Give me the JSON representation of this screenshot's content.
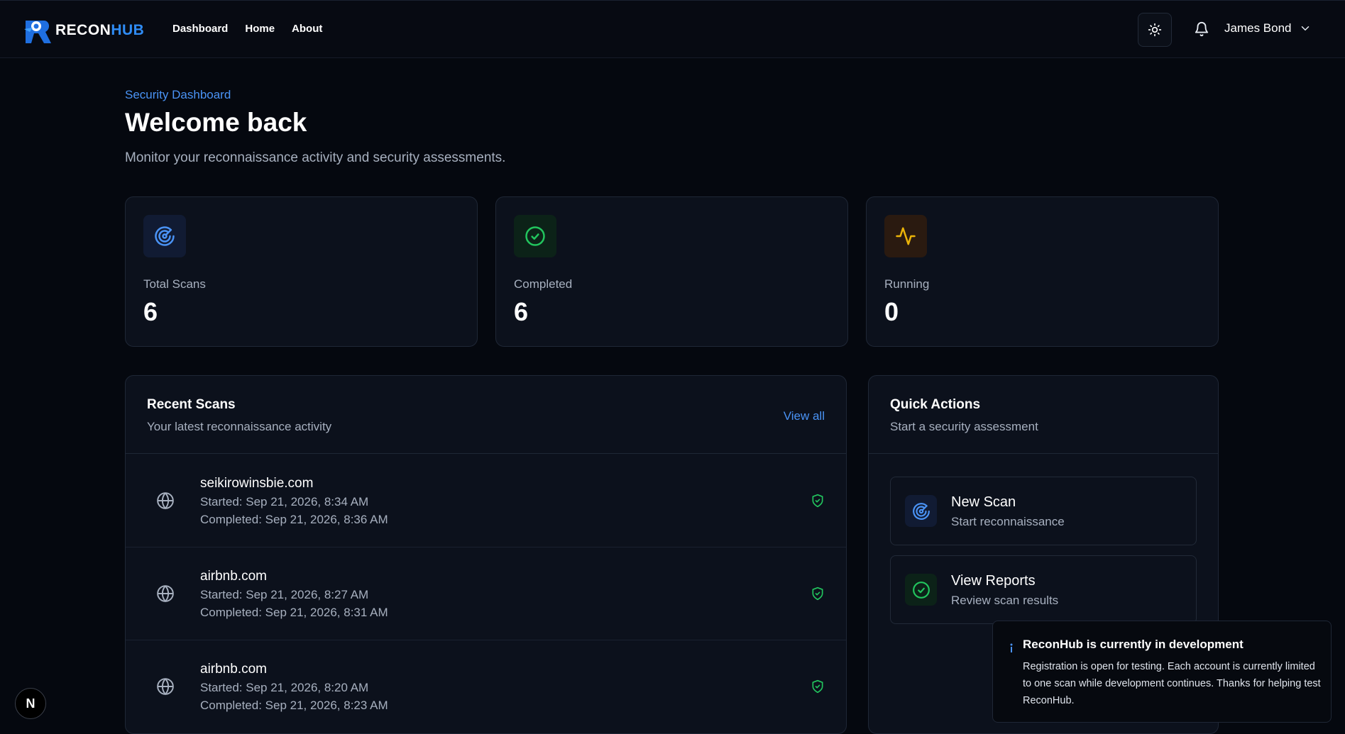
{
  "brand": {
    "name_part1": "RECON",
    "name_part2": "HUB",
    "logo_letter": "R"
  },
  "nav": {
    "items": [
      "Dashboard",
      "Home",
      "About"
    ]
  },
  "user": {
    "name": "James Bond"
  },
  "header": {
    "eyebrow": "Security Dashboard",
    "title": "Welcome back",
    "subtitle": "Monitor your reconnaissance activity and security assessments."
  },
  "stats": [
    {
      "label": "Total Scans",
      "value": "6",
      "icon": "radar-icon",
      "color": "#4a93f5"
    },
    {
      "label": "Completed",
      "value": "6",
      "icon": "check-circle-icon",
      "color": "#22c55e"
    },
    {
      "label": "Running",
      "value": "0",
      "icon": "activity-icon",
      "color": "#eab308"
    }
  ],
  "recent_scans": {
    "title": "Recent Scans",
    "subtitle": "Your latest reconnaissance activity",
    "view_all": "View all",
    "items": [
      {
        "domain": "seikirowinsbie.com",
        "started": "Started: Sep 21, 2026, 8:34 AM",
        "completed": "Completed: Sep 21, 2026, 8:36 AM"
      },
      {
        "domain": "airbnb.com",
        "started": "Started: Sep 21, 2026, 8:27 AM",
        "completed": "Completed: Sep 21, 2026, 8:31 AM"
      },
      {
        "domain": "airbnb.com",
        "started": "Started: Sep 21, 2026, 8:20 AM",
        "completed": "Completed: Sep 21, 2026, 8:23 AM"
      }
    ]
  },
  "quick_actions": {
    "title": "Quick Actions",
    "subtitle": "Start a security assessment",
    "items": [
      {
        "title": "New Scan",
        "subtitle": "Start reconnaissance",
        "icon": "radar-icon"
      },
      {
        "title": "View Reports",
        "subtitle": "Review scan results",
        "icon": "check-circle-icon"
      }
    ]
  },
  "toast": {
    "title": "ReconHub is currently in development",
    "body": "Registration is open for testing. Each account is currently limited to one scan while development continues. Thanks for helping test ReconHub."
  },
  "dev_badge": {
    "letter": "N"
  },
  "colors": {
    "accent": "#4a93f5",
    "success": "#22c55e",
    "warning": "#eab308",
    "background": "#05080f",
    "card": "#0c111c"
  }
}
